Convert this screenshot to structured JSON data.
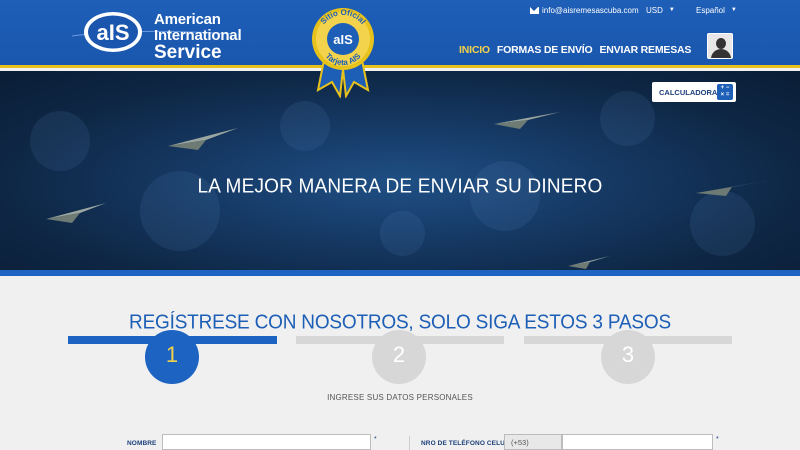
{
  "brand": {
    "line1": "American",
    "line2": "International",
    "line3": "Service",
    "mark": "aIS",
    "badge_top": "Sitio Oficial",
    "badge_bottom": "Tarjeta AIS",
    "badge_mark": "aIS",
    "colors": {
      "primary": "#1d5fb6",
      "accent": "#e8c21c",
      "active_nav": "#f3d24a"
    }
  },
  "topbar": {
    "email_icon": "envelope-icon",
    "email": "info@aisremesascuba.com",
    "currency": "USD",
    "language": "Español"
  },
  "nav": {
    "items": [
      {
        "label": "INICIO",
        "active": true
      },
      {
        "label": "FORMAS DE ENVÍO",
        "active": false
      },
      {
        "label": "ENVIAR REMESAS",
        "active": false
      }
    ],
    "user_icon": "user-avatar-icon"
  },
  "hero": {
    "title": "LA MEJOR MANERA DE ENVIAR SU DINERO",
    "calculator_label": "CALCULADORA",
    "calculator_icon": "calculator-icon"
  },
  "registration": {
    "title": "REGÍSTRESE CON NOSOTROS, SOLO SIGA ESTOS 3 PASOS",
    "steps": [
      {
        "number": "1",
        "active": true
      },
      {
        "number": "2",
        "active": false
      },
      {
        "number": "3",
        "active": false
      }
    ],
    "section_label": "INGRESE SUS DATOS PERSONALES",
    "fields": {
      "name_label": "NOMBRE",
      "name_value": "",
      "phone_label": "NRO DE TELÉFONO CELULAR",
      "phone_prefix": "(+53)",
      "phone_value": "",
      "required_mark": "*"
    }
  }
}
